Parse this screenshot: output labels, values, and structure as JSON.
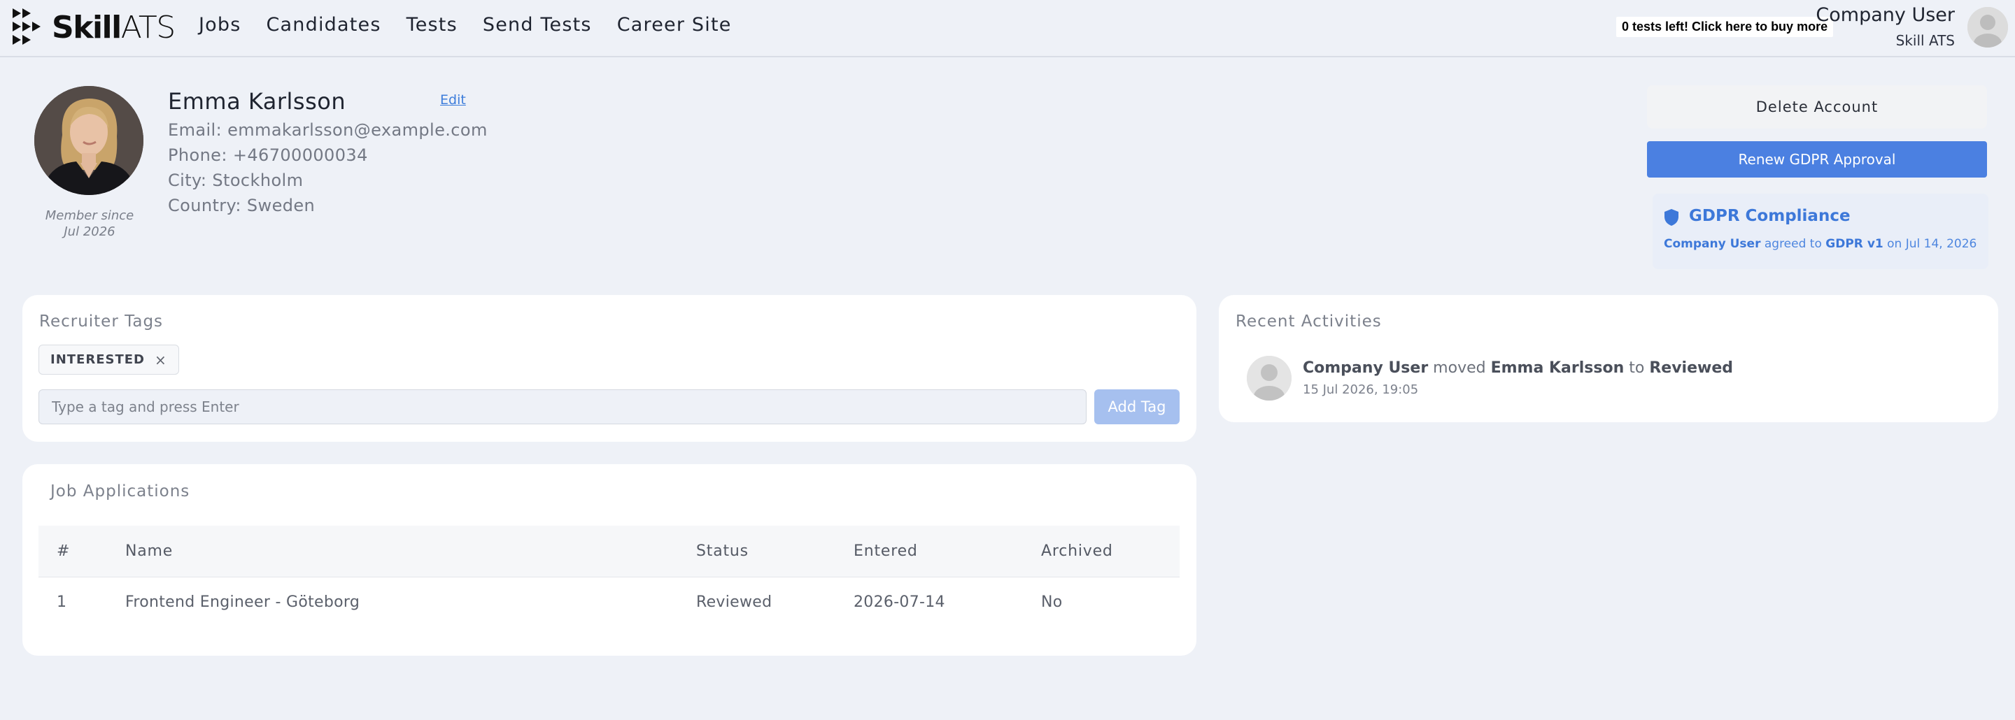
{
  "nav": {
    "logo_bold": "Skill",
    "logo_light": "ATS",
    "links": [
      "Jobs",
      "Candidates",
      "Tests",
      "Send Tests",
      "Career Site"
    ],
    "tests_notice": "0 tests left! Click here to buy more",
    "user_name": "Company User",
    "user_company": "Skill ATS"
  },
  "candidate": {
    "name": "Emma Karlsson",
    "edit_label": "Edit",
    "email": "Email: emmakarlsson@example.com",
    "phone": "Phone: +46700000034",
    "city": "City: Stockholm",
    "country": "Country: Sweden",
    "member_since_label": "Member since",
    "member_since_date": "Jul 2026"
  },
  "actions": {
    "delete_label": "Delete Account",
    "renew_label": "Renew GDPR Approval"
  },
  "gdpr": {
    "title": "GDPR Compliance",
    "user": "Company User",
    "agreed_text": "agreed to",
    "version": "GDPR v1",
    "on_text": "on Jul 14, 2026"
  },
  "tags": {
    "title": "Recruiter Tags",
    "items": [
      "INTERESTED"
    ],
    "remove_glyph": "×",
    "input_placeholder": "Type a tag and press Enter",
    "add_label": "Add Tag"
  },
  "applications": {
    "title": "Job Applications",
    "columns": [
      "#",
      "Name",
      "Status",
      "Entered",
      "Archived"
    ],
    "rows": [
      [
        "1",
        "Frontend Engineer - Göteborg",
        "Reviewed",
        "2026-07-14",
        "No"
      ]
    ]
  },
  "activities": {
    "title": "Recent Activities",
    "items": [
      {
        "actor": "Company User",
        "verb": "moved",
        "subject": "Emma Karlsson",
        "prep": "to",
        "target": "Reviewed",
        "time": "15 Jul 2026, 19:05"
      }
    ]
  },
  "colors": {
    "background": "#eef1f7",
    "primary": "#4b80e1",
    "primary_disabled": "#a6c0ef",
    "gdpr_accent": "#3d78d9"
  }
}
